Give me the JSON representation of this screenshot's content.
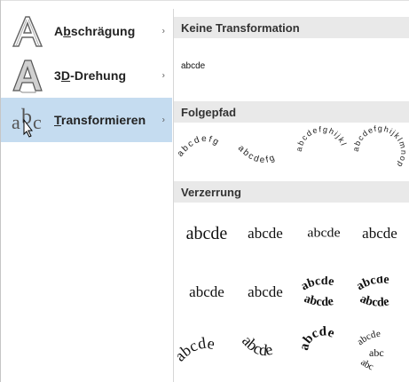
{
  "menu": {
    "items": [
      {
        "label_pre": "A",
        "label_ul": "b",
        "label_post": "schrägung",
        "active": false,
        "icon": "bevel-a-icon"
      },
      {
        "label_pre": "3",
        "label_ul": "D",
        "label_post": "-Drehung",
        "active": false,
        "icon": "3d-rotation-a-icon"
      },
      {
        "label_pre": "",
        "label_ul": "T",
        "label_post": "ransformieren",
        "active": true,
        "icon": "transform-abc-icon"
      }
    ],
    "arrow": "›"
  },
  "sections": {
    "none": {
      "title": "Keine Transformation",
      "sample": "abcde"
    },
    "path": {
      "title": "Folgepfad"
    },
    "warp": {
      "title": "Verzerrung"
    }
  },
  "path_samples": [
    "abcdefg",
    "abcdefg",
    "abcdefghijkl",
    "abcdefghijklmnop"
  ],
  "warp_samples": [
    "abcde",
    "abcde",
    "abcde",
    "abcde",
    "abcde",
    "abcde",
    "abcde",
    "abcde",
    "abcde",
    "abcde",
    "abcde",
    "abc"
  ],
  "colors": {
    "active_bg": "#c5dcf0",
    "header_bg": "#e9e9e9"
  }
}
